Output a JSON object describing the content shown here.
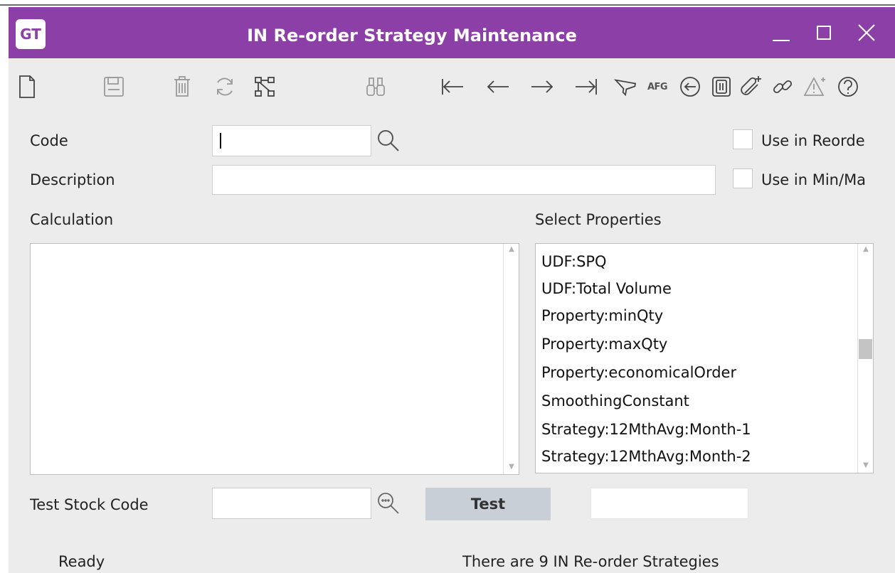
{
  "window": {
    "logo_text": "GT",
    "title": "IN Re-order Strategy Maintenance",
    "accent_color": "#8d3fa8"
  },
  "titlebar_buttons": [
    "minimize-icon",
    "maximize-icon",
    "close-icon"
  ],
  "toolbar": {
    "icons": [
      "new-document-icon",
      "save-icon",
      "delete-icon",
      "refresh-icon",
      "hierarchy-icon",
      "binoculars-icon",
      "first-record-icon",
      "previous-record-icon",
      "next-record-icon",
      "last-record-icon",
      "funnel-icon",
      "afg-icon",
      "back-circle-icon",
      "clipboard-icon",
      "attach-add-icon",
      "link-icon",
      "warning-icon",
      "help-icon"
    ],
    "afg_label": "AFG"
  },
  "form": {
    "code_label": "Code",
    "code_value": "",
    "description_label": "Description",
    "description_value": "",
    "use_in_reorder_label": "Use in Reorde",
    "use_in_minmax_label": "Use in Min/Ma",
    "calculation_label": "Calculation",
    "calculation_value": "",
    "select_properties_label": "Select Properties",
    "properties": [
      "UDF:SPQ",
      "UDF:Total Volume",
      "Property:minQty",
      "Property:maxQty",
      "Property:economicalOrder",
      "SmoothingConstant",
      "Strategy:12MthAvg:Month-1",
      "Strategy:12MthAvg:Month-2"
    ],
    "test_stock_code_label": "Test Stock Code",
    "test_stock_code_value": "",
    "test_button": "Test",
    "test_result": ""
  },
  "status": {
    "left": "Ready",
    "right": "There are 9 IN Re-order Strategies"
  }
}
